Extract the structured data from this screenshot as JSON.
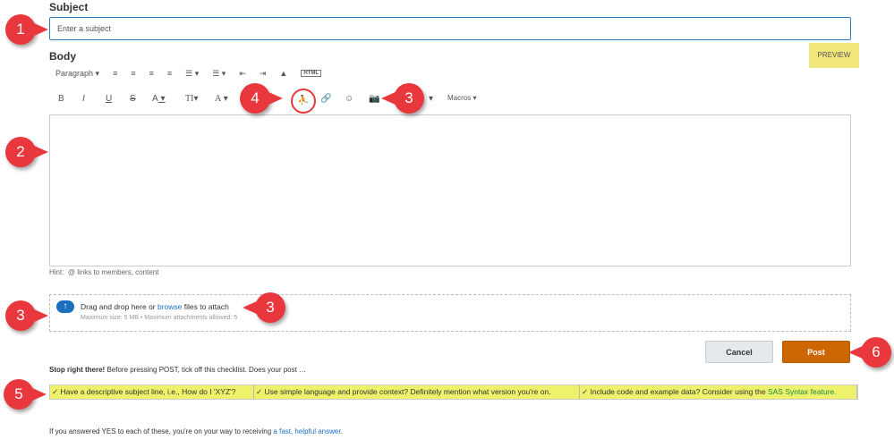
{
  "subject": {
    "label": "Subject",
    "placeholder": "Enter a subject"
  },
  "body": {
    "label": "Body",
    "preview": "PREVIEW"
  },
  "toolbar": {
    "paragraph": "Paragraph",
    "html": "HTML",
    "bold": "B",
    "italic": "I",
    "underline": "U",
    "strike": "S",
    "font_color": "A",
    "text_size": "TI",
    "font": "A",
    "macros": "Macros"
  },
  "hint": {
    "label": "Hint:",
    "text": "@ links to members, content"
  },
  "attach": {
    "text_before": "Drag and drop here or ",
    "browse": "browse",
    "text_after": " files to attach",
    "limits": "Maximum size: 5 MB • Maximum attachments allowed: 5"
  },
  "buttons": {
    "cancel": "Cancel",
    "post": "Post"
  },
  "stop": {
    "bold": "Stop right there!",
    "text": " Before pressing POST, tick off this checklist. Does your post …"
  },
  "checklist": [
    {
      "text": "✓ Have a descriptive subject line, i.e., How do I 'XYZ'?"
    },
    {
      "text": "✓ Use simple language and provide context? Definitely mention what version you're on."
    },
    {
      "text": "✓ Include code and example data? Consider using the ",
      "link": "SAS Syntax feature."
    }
  ],
  "footer": {
    "text": "If you answered YES to each of these, you're on your way to receiving ",
    "link": "a fast, helpful answer",
    "end": "."
  },
  "callouts": [
    "1",
    "2",
    "3",
    "4",
    "3",
    "3",
    "5",
    "6"
  ]
}
